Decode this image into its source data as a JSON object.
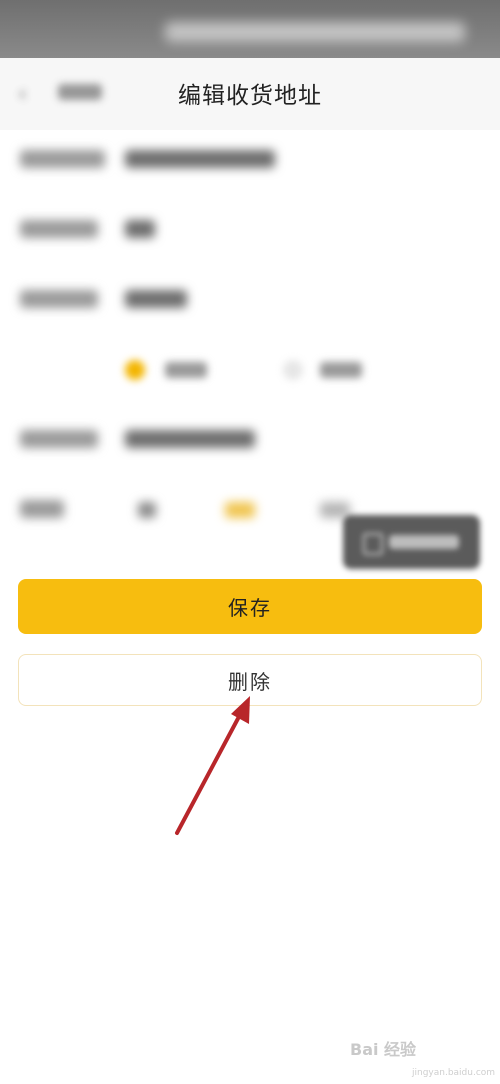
{
  "header": {
    "title": "编辑收货地址"
  },
  "actions": {
    "save_label": "保存",
    "delete_label": "删除"
  },
  "colors": {
    "accent": "#f7bd0f",
    "arrow": "#b8262a"
  },
  "icons": {
    "back": "chevron-left-icon",
    "annotation": "red-arrow-icon"
  },
  "watermark": {
    "text": "Bai 经验",
    "url": "jingyan.baidu.com"
  }
}
